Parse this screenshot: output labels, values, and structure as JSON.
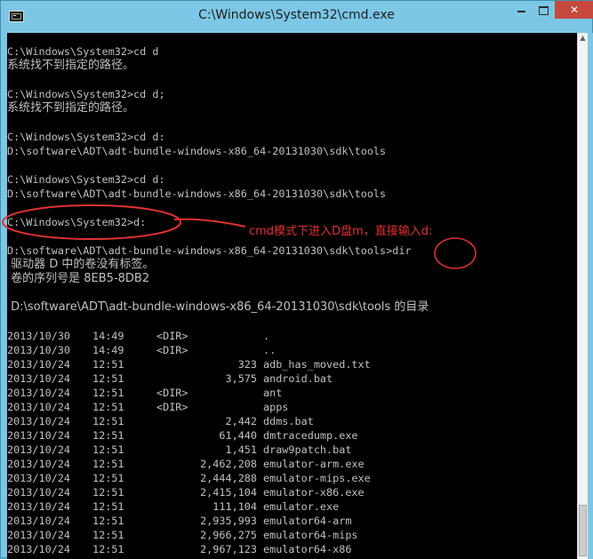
{
  "window": {
    "title": "C:\\Windows\\System32\\cmd.exe",
    "close_label": "✕"
  },
  "console": {
    "lines": [
      "C:\\Windows\\System32>cd d",
      "系统找不到指定的路径。",
      "C:\\Windows\\System32>cd d;",
      "系统找不到指定的路径。",
      "C:\\Windows\\System32>cd d:",
      "D:\\software\\ADT\\adt-bundle-windows-x86_64-20131030\\sdk\\tools",
      "C:\\Windows\\System32>cd d:",
      "D:\\software\\ADT\\adt-bundle-windows-x86_64-20131030\\sdk\\tools",
      "C:\\Windows\\System32>d:",
      "D:\\software\\ADT\\adt-bundle-windows-x86_64-20131030\\sdk\\tools>dir",
      " 驱动器 D 中的卷没有标签。",
      " 卷的序列号是 8EB5-8DB2",
      " D:\\software\\ADT\\adt-bundle-windows-x86_64-20131030\\sdk\\tools 的目录"
    ],
    "listing": [
      {
        "date": "2013/10/30",
        "time": "14:49",
        "type": "<DIR>",
        "size": "",
        "name": "."
      },
      {
        "date": "2013/10/30",
        "time": "14:49",
        "type": "<DIR>",
        "size": "",
        "name": ".."
      },
      {
        "date": "2013/10/24",
        "time": "12:51",
        "type": "",
        "size": "323",
        "name": "adb_has_moved.txt"
      },
      {
        "date": "2013/10/24",
        "time": "12:51",
        "type": "",
        "size": "3,575",
        "name": "android.bat"
      },
      {
        "date": "2013/10/24",
        "time": "12:51",
        "type": "<DIR>",
        "size": "",
        "name": "ant"
      },
      {
        "date": "2013/10/24",
        "time": "12:51",
        "type": "<DIR>",
        "size": "",
        "name": "apps"
      },
      {
        "date": "2013/10/24",
        "time": "12:51",
        "type": "",
        "size": "2,442",
        "name": "ddms.bat"
      },
      {
        "date": "2013/10/24",
        "time": "12:51",
        "type": "",
        "size": "61,440",
        "name": "dmtracedump.exe"
      },
      {
        "date": "2013/10/24",
        "time": "12:51",
        "type": "",
        "size": "1,451",
        "name": "draw9patch.bat"
      },
      {
        "date": "2013/10/24",
        "time": "12:51",
        "type": "",
        "size": "2,462,208",
        "name": "emulator-arm.exe"
      },
      {
        "date": "2013/10/24",
        "time": "12:51",
        "type": "",
        "size": "2,444,288",
        "name": "emulator-mips.exe"
      },
      {
        "date": "2013/10/24",
        "time": "12:51",
        "type": "",
        "size": "2,415,104",
        "name": "emulator-x86.exe"
      },
      {
        "date": "2013/10/24",
        "time": "12:51",
        "type": "",
        "size": "111,104",
        "name": "emulator.exe"
      },
      {
        "date": "2013/10/24",
        "time": "12:51",
        "type": "",
        "size": "2,935,993",
        "name": "emulator64-arm"
      },
      {
        "date": "2013/10/24",
        "time": "12:51",
        "type": "",
        "size": "2,966,275",
        "name": "emulator64-mips"
      },
      {
        "date": "2013/10/24",
        "time": "12:51",
        "type": "",
        "size": "2,967,123",
        "name": "emulator64-x86"
      }
    ]
  },
  "annotation": {
    "text": "cmd模式下进入D盘m，直接输入d:",
    "color": "#e33131"
  },
  "colors": {
    "console_bg": "#000000",
    "console_text": "#c0c0c0",
    "titlebar": "#7cc7e6",
    "close_button": "#c7483d"
  }
}
